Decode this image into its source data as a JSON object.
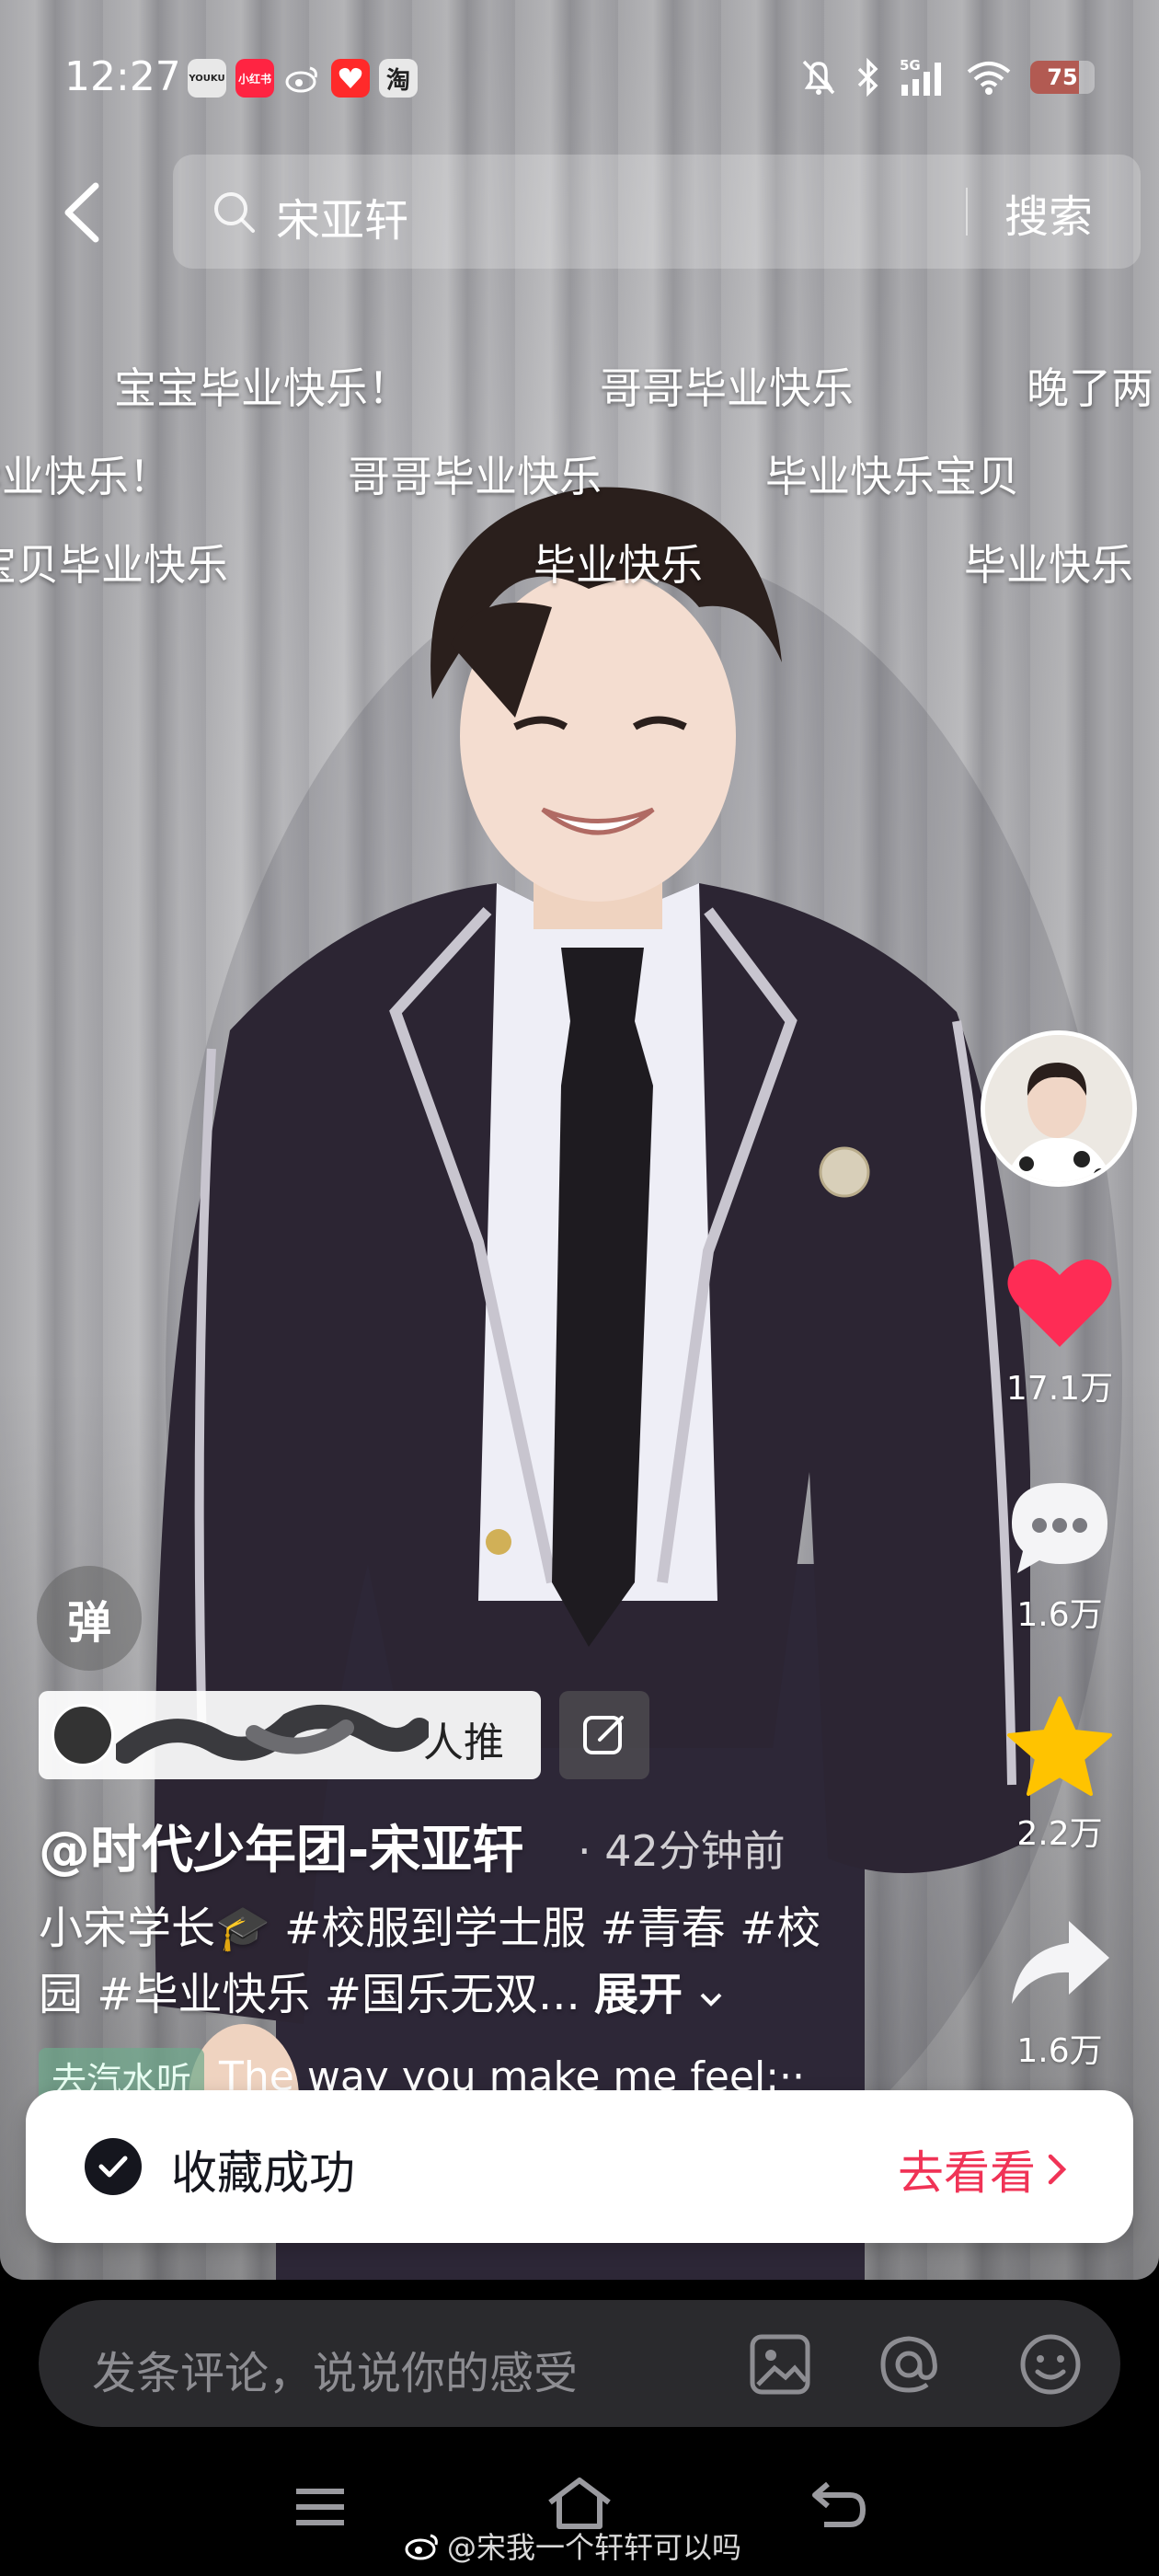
{
  "status_bar": {
    "time": "12:27",
    "apps": [
      {
        "name": "youku",
        "label": "YOUKU",
        "bg": "#e8e8e8",
        "fg": "#222"
      },
      {
        "name": "xiaohongshu",
        "label": "小红书",
        "bg": "#ff2442",
        "fg": "#fff"
      },
      {
        "name": "weibo",
        "label": "",
        "bg": "transparent",
        "fg": "#fff"
      },
      {
        "name": "meituan",
        "label": "",
        "bg": "#ff2a2a",
        "fg": "#fff"
      },
      {
        "name": "taobao",
        "label": "淘",
        "bg": "#e8e8e8",
        "fg": "#222"
      }
    ],
    "network": "5G",
    "battery": "75",
    "battery_level": 0.75
  },
  "search": {
    "query": "宋亚轩",
    "button_label": "搜索"
  },
  "danmaku": [
    "宝宝毕业快乐！",
    "哥哥毕业快乐",
    "晚了两",
    "毕业快乐！",
    "哥哥毕业快乐",
    "毕业快乐宝贝",
    "宝贝毕业快乐",
    "毕业快乐",
    "毕业快乐"
  ],
  "actions": {
    "likes": "17.1万",
    "comments": "1.6万",
    "favorites": "2.2万",
    "shares": "1.6万"
  },
  "colors": {
    "like": "#fe2c55",
    "favorite": "#ffc300",
    "toast_action": "#f03356"
  },
  "post": {
    "danmaku_toggle": "弹",
    "recommend_label": "人推荐",
    "author": "@时代少年团-宋亚轩",
    "time": "· 42分钟前",
    "caption_line1": "小宋学长🎓 #校服到学士服 #青春 #校",
    "caption_line2": "园 #毕业快乐 #国乐无双...",
    "expand_label": "展开",
    "music_tag": "去汽水听",
    "music_title": "The way you make me feel:··"
  },
  "toast": {
    "message": "收藏成功",
    "action": "去看看"
  },
  "comment_bar": {
    "placeholder": "发条评论，说说你的感受"
  },
  "watermark": "@宋我一个轩轩可以吗"
}
